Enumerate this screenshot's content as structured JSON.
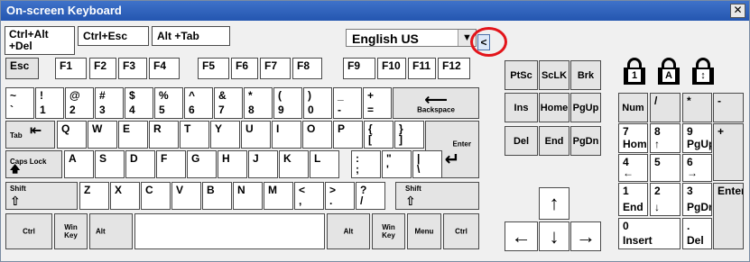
{
  "window": {
    "title": "On-screen Keyboard",
    "close": "✕"
  },
  "hotkeys": [
    "Ctrl+Alt\n+Del",
    "Ctrl+Esc",
    "Alt +Tab"
  ],
  "language": {
    "value": "English US",
    "dropdown": "▼"
  },
  "collapse": "<",
  "locks": [
    "1",
    "A",
    "↕"
  ],
  "fkeys": [
    "Esc",
    "F1",
    "F2",
    "F3",
    "F4",
    "F5",
    "F6",
    "F7",
    "F8",
    "F9",
    "F10",
    "F11",
    "F12"
  ],
  "row1": [
    {
      "t": "~",
      "b": "`"
    },
    {
      "t": "!",
      "b": "1"
    },
    {
      "t": "@",
      "b": "2"
    },
    {
      "t": "#",
      "b": "3"
    },
    {
      "t": "$",
      "b": "4"
    },
    {
      "t": "%",
      "b": "5"
    },
    {
      "t": "^",
      "b": "6"
    },
    {
      "t": "&",
      "b": "7"
    },
    {
      "t": "*",
      "b": "8"
    },
    {
      "t": "(",
      "b": "9"
    },
    {
      "t": ")",
      "b": "0"
    },
    {
      "t": "_",
      "b": "-"
    },
    {
      "t": "+",
      "b": "="
    }
  ],
  "backspace": "Backspace",
  "row2": [
    "Q",
    "W",
    "E",
    "R",
    "T",
    "Y",
    "U",
    "I",
    "O",
    "P"
  ],
  "row2sym": [
    {
      "t": "{",
      "b": "["
    },
    {
      "t": "}",
      "b": "]"
    }
  ],
  "tab": "Tab",
  "enter": "Enter",
  "capslock": "Caps Lock",
  "row3": [
    "A",
    "S",
    "D",
    "F",
    "G",
    "H",
    "J",
    "K",
    "L"
  ],
  "row3sym": [
    {
      "t": ":",
      "b": ";"
    },
    {
      "t": "\"",
      "b": "'"
    },
    {
      "t": "|",
      "b": "\\"
    }
  ],
  "shift": "Shift",
  "row4": [
    "Z",
    "X",
    "C",
    "V",
    "B",
    "N",
    "M"
  ],
  "row4sym": [
    {
      "t": "<",
      "b": ","
    },
    {
      "t": ">",
      "b": "."
    },
    {
      "t": "?",
      "b": "/"
    }
  ],
  "bottom": {
    "ctrl": "Ctrl",
    "win": "Win\nKey",
    "alt": "Alt",
    "menu": "Menu"
  },
  "nav": {
    "prtsc": "PtSc",
    "sclk": "ScLK",
    "brk": "Brk",
    "ins": "Ins",
    "home": "Home",
    "pgup": "PgUp",
    "del": "Del",
    "end": "End",
    "pgdn": "PgDn"
  },
  "numpad": {
    "num": "Num",
    "div": "/",
    "mul": "*",
    "sub": "-",
    "n7": {
      "t": "7",
      "b": "Home"
    },
    "n8": {
      "t": "8",
      "b": "↑"
    },
    "n9": {
      "t": "9",
      "b": "PgUp"
    },
    "add": "+",
    "n4": {
      "t": "4",
      "b": "←"
    },
    "n5": {
      "t": "5",
      "b": ""
    },
    "n6": {
      "t": "6",
      "b": "→"
    },
    "n1": {
      "t": "1",
      "b": "End"
    },
    "n2": {
      "t": "2",
      "b": "↓"
    },
    "n3": {
      "t": "3",
      "b": "PgDn"
    },
    "enter": "Enter",
    "n0": {
      "t": "0",
      "b": "Insert"
    },
    "dot": {
      "t": ".",
      "b": "Del"
    }
  },
  "arrows": {
    "up": "↑",
    "down": "↓",
    "left": "←",
    "right": "→"
  }
}
